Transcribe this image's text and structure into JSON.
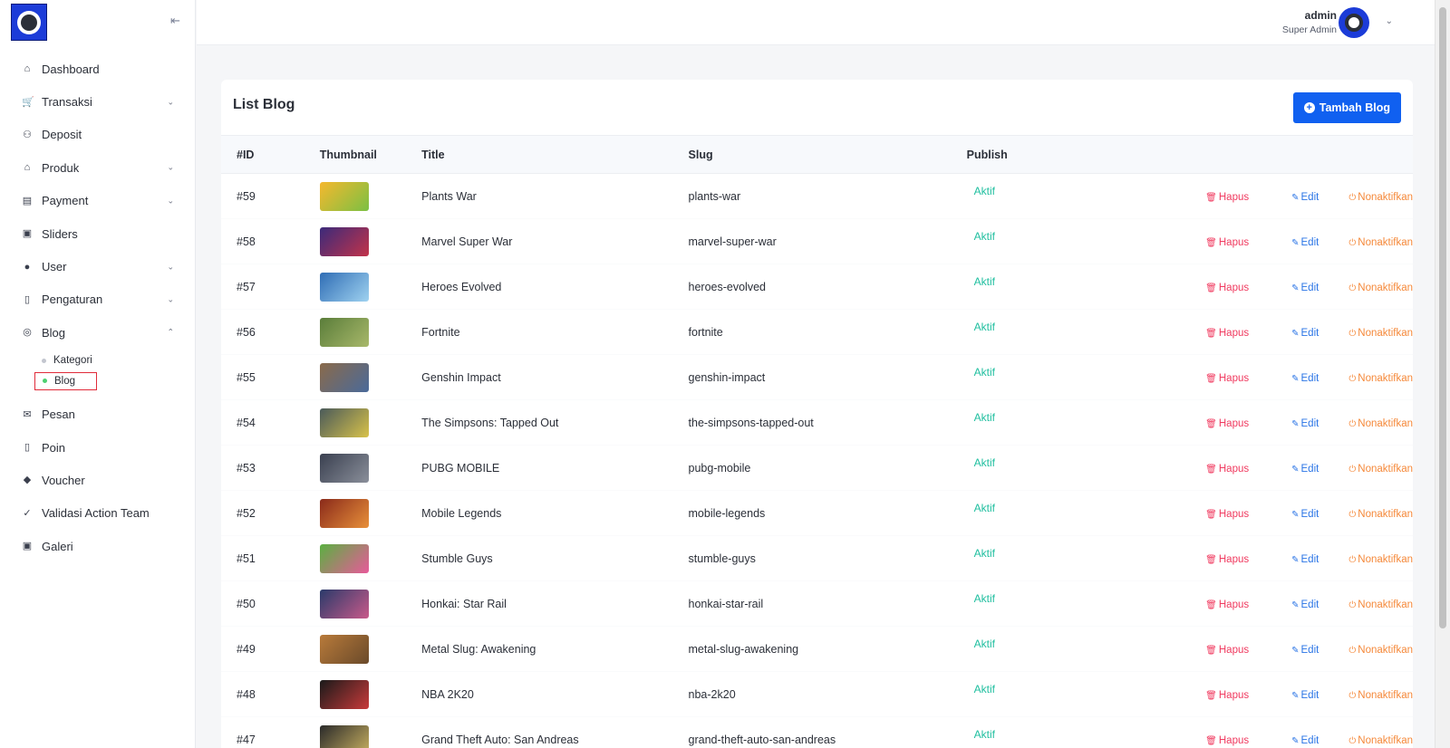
{
  "topbar": {
    "user_name": "admin",
    "user_role": "Super Admin"
  },
  "sidebar": {
    "items": [
      {
        "label": "Dashboard",
        "icon": "home-icon",
        "glyph": "⌂",
        "chevron": ""
      },
      {
        "label": "Transaksi",
        "icon": "cart-icon",
        "glyph": "🛒",
        "chevron": "⌄"
      },
      {
        "label": "Deposit",
        "icon": "deposit-icon",
        "glyph": "⚇",
        "chevron": ""
      },
      {
        "label": "Produk",
        "icon": "store-icon",
        "glyph": "⌂",
        "chevron": "⌄"
      },
      {
        "label": "Payment",
        "icon": "payment-icon",
        "glyph": "▤",
        "chevron": "⌄"
      },
      {
        "label": "Sliders",
        "icon": "image-icon",
        "glyph": "▣",
        "chevron": ""
      },
      {
        "label": "User",
        "icon": "user-icon",
        "glyph": "●",
        "chevron": "⌄"
      },
      {
        "label": "Pengaturan",
        "icon": "settings-icon",
        "glyph": "▯",
        "chevron": "⌄"
      },
      {
        "label": "Blog",
        "icon": "globe-icon",
        "glyph": "◎",
        "chevron": "⌃"
      }
    ],
    "blog_sub": [
      {
        "label": "Kategori",
        "active": false
      },
      {
        "label": "Blog",
        "active": true
      }
    ],
    "items_after": [
      {
        "label": "Pesan",
        "icon": "mail-icon",
        "glyph": "✉",
        "chevron": ""
      },
      {
        "label": "Poin",
        "icon": "points-icon",
        "glyph": "▯",
        "chevron": ""
      },
      {
        "label": "Voucher",
        "icon": "voucher-icon",
        "glyph": "◆",
        "chevron": ""
      },
      {
        "label": "Validasi Action Team",
        "icon": "check-icon",
        "glyph": "✓",
        "chevron": ""
      },
      {
        "label": "Galeri",
        "icon": "gallery-icon",
        "glyph": "▣",
        "chevron": ""
      }
    ]
  },
  "main": {
    "title": "List Blog",
    "add_button": "Tambah Blog",
    "columns": [
      "#ID",
      "Thumbnail",
      "Title",
      "Slug",
      "Publish"
    ],
    "actions": {
      "delete": "Hapus",
      "edit": "Edit",
      "deactivate": "Nonaktifkan"
    },
    "rows": [
      {
        "id": "#59",
        "title": "Plants War",
        "slug": "plants-war",
        "publish": "Aktif",
        "thumb": [
          "#f5b82e",
          "#7bc043"
        ]
      },
      {
        "id": "#58",
        "title": "Marvel Super War",
        "slug": "marvel-super-war",
        "publish": "Aktif",
        "thumb": [
          "#3b2a7a",
          "#c2334a"
        ]
      },
      {
        "id": "#57",
        "title": "Heroes Evolved",
        "slug": "heroes-evolved",
        "publish": "Aktif",
        "thumb": [
          "#2f6db5",
          "#9fd2f0"
        ]
      },
      {
        "id": "#56",
        "title": "Fortnite",
        "slug": "fortnite",
        "publish": "Aktif",
        "thumb": [
          "#5a7d3a",
          "#a8b86a"
        ]
      },
      {
        "id": "#55",
        "title": "Genshin Impact",
        "slug": "genshin-impact",
        "publish": "Aktif",
        "thumb": [
          "#8a6a4a",
          "#4a6a9a"
        ]
      },
      {
        "id": "#54",
        "title": "The Simpsons: Tapped Out",
        "slug": "the-simpsons-tapped-out",
        "publish": "Aktif",
        "thumb": [
          "#4a5a5a",
          "#d8c24a"
        ]
      },
      {
        "id": "#53",
        "title": "PUBG MOBILE",
        "slug": "pubg-mobile",
        "publish": "Aktif",
        "thumb": [
          "#3a4050",
          "#8a8f9a"
        ]
      },
      {
        "id": "#52",
        "title": "Mobile Legends",
        "slug": "mobile-legends",
        "publish": "Aktif",
        "thumb": [
          "#8a2a1a",
          "#e8903a"
        ]
      },
      {
        "id": "#51",
        "title": "Stumble Guys",
        "slug": "stumble-guys",
        "publish": "Aktif",
        "thumb": [
          "#5ab040",
          "#e85a9a"
        ]
      },
      {
        "id": "#50",
        "title": "Honkai: Star Rail",
        "slug": "honkai-star-rail",
        "publish": "Aktif",
        "thumb": [
          "#2a3a6a",
          "#c85a8a"
        ]
      },
      {
        "id": "#49",
        "title": "Metal Slug: Awakening",
        "slug": "metal-slug-awakening",
        "publish": "Aktif",
        "thumb": [
          "#b87a3a",
          "#6a4a2a"
        ]
      },
      {
        "id": "#48",
        "title": "NBA 2K20",
        "slug": "nba-2k20",
        "publish": "Aktif",
        "thumb": [
          "#1a1a1a",
          "#c83a3a"
        ]
      },
      {
        "id": "#47",
        "title": "Grand Theft Auto: San Andreas",
        "slug": "grand-theft-auto-san-andreas",
        "publish": "Aktif",
        "thumb": [
          "#2a2a2a",
          "#c8b060"
        ]
      }
    ]
  }
}
